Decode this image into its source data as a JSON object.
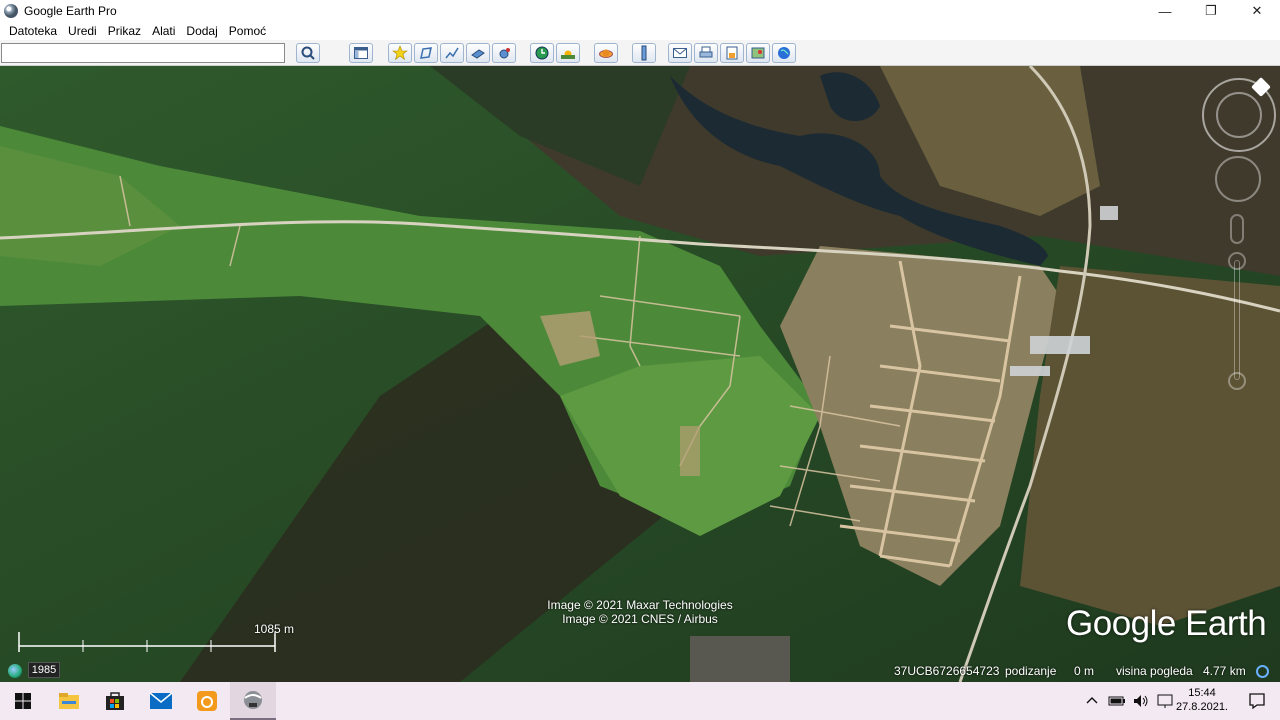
{
  "window": {
    "title": "Google Earth Pro",
    "controls": {
      "minimize": "—",
      "maximize": "❐",
      "close": "✕"
    }
  },
  "menu": {
    "items": [
      "Datoteka",
      "Uredi",
      "Prikaz",
      "Alati",
      "Dodaj",
      "Pomoć"
    ]
  },
  "toolbar": {
    "search": {
      "value": "",
      "placeholder": ""
    },
    "buttons": [
      "search-icon",
      "sidebar-icon",
      "placemark-icon",
      "polygon-icon",
      "path-icon",
      "overlay-icon",
      "record-tour-icon",
      "historical-imagery-icon",
      "sunlight-icon",
      "planets-icon",
      "ruler-icon",
      "email-icon",
      "print-icon",
      "save-image-icon",
      "view-maps-icon",
      "earth-icon"
    ]
  },
  "map": {
    "attribution": [
      "Image © 2021 Maxar Technologies",
      "Image © 2021 CNES / Airbus"
    ],
    "logo": "Google Earth",
    "scale_label": "1085 m",
    "year_badge": "1985",
    "status": {
      "coordinates": "37UCB6726654723",
      "elevation_label": "podizanje",
      "elevation_value": "0 m",
      "eye_alt_label": "visina pogleda",
      "eye_alt_value": "4.77 km"
    }
  },
  "taskbar": {
    "apps": [
      "windows-start-icon",
      "file-explorer-icon",
      "store-icon",
      "mail-icon",
      "app-orange-icon",
      "google-earth-icon"
    ],
    "tray": [
      "chevron-up-icon",
      "battery-icon",
      "volume-icon",
      "display-icon"
    ],
    "time": "15:44",
    "date": "27.8.2021."
  },
  "colors": {
    "forest_dark": "#1e3a1f",
    "field_green": "#4f8a3c",
    "dirt_road": "#d9c4a2",
    "river": "#1b2a33"
  }
}
